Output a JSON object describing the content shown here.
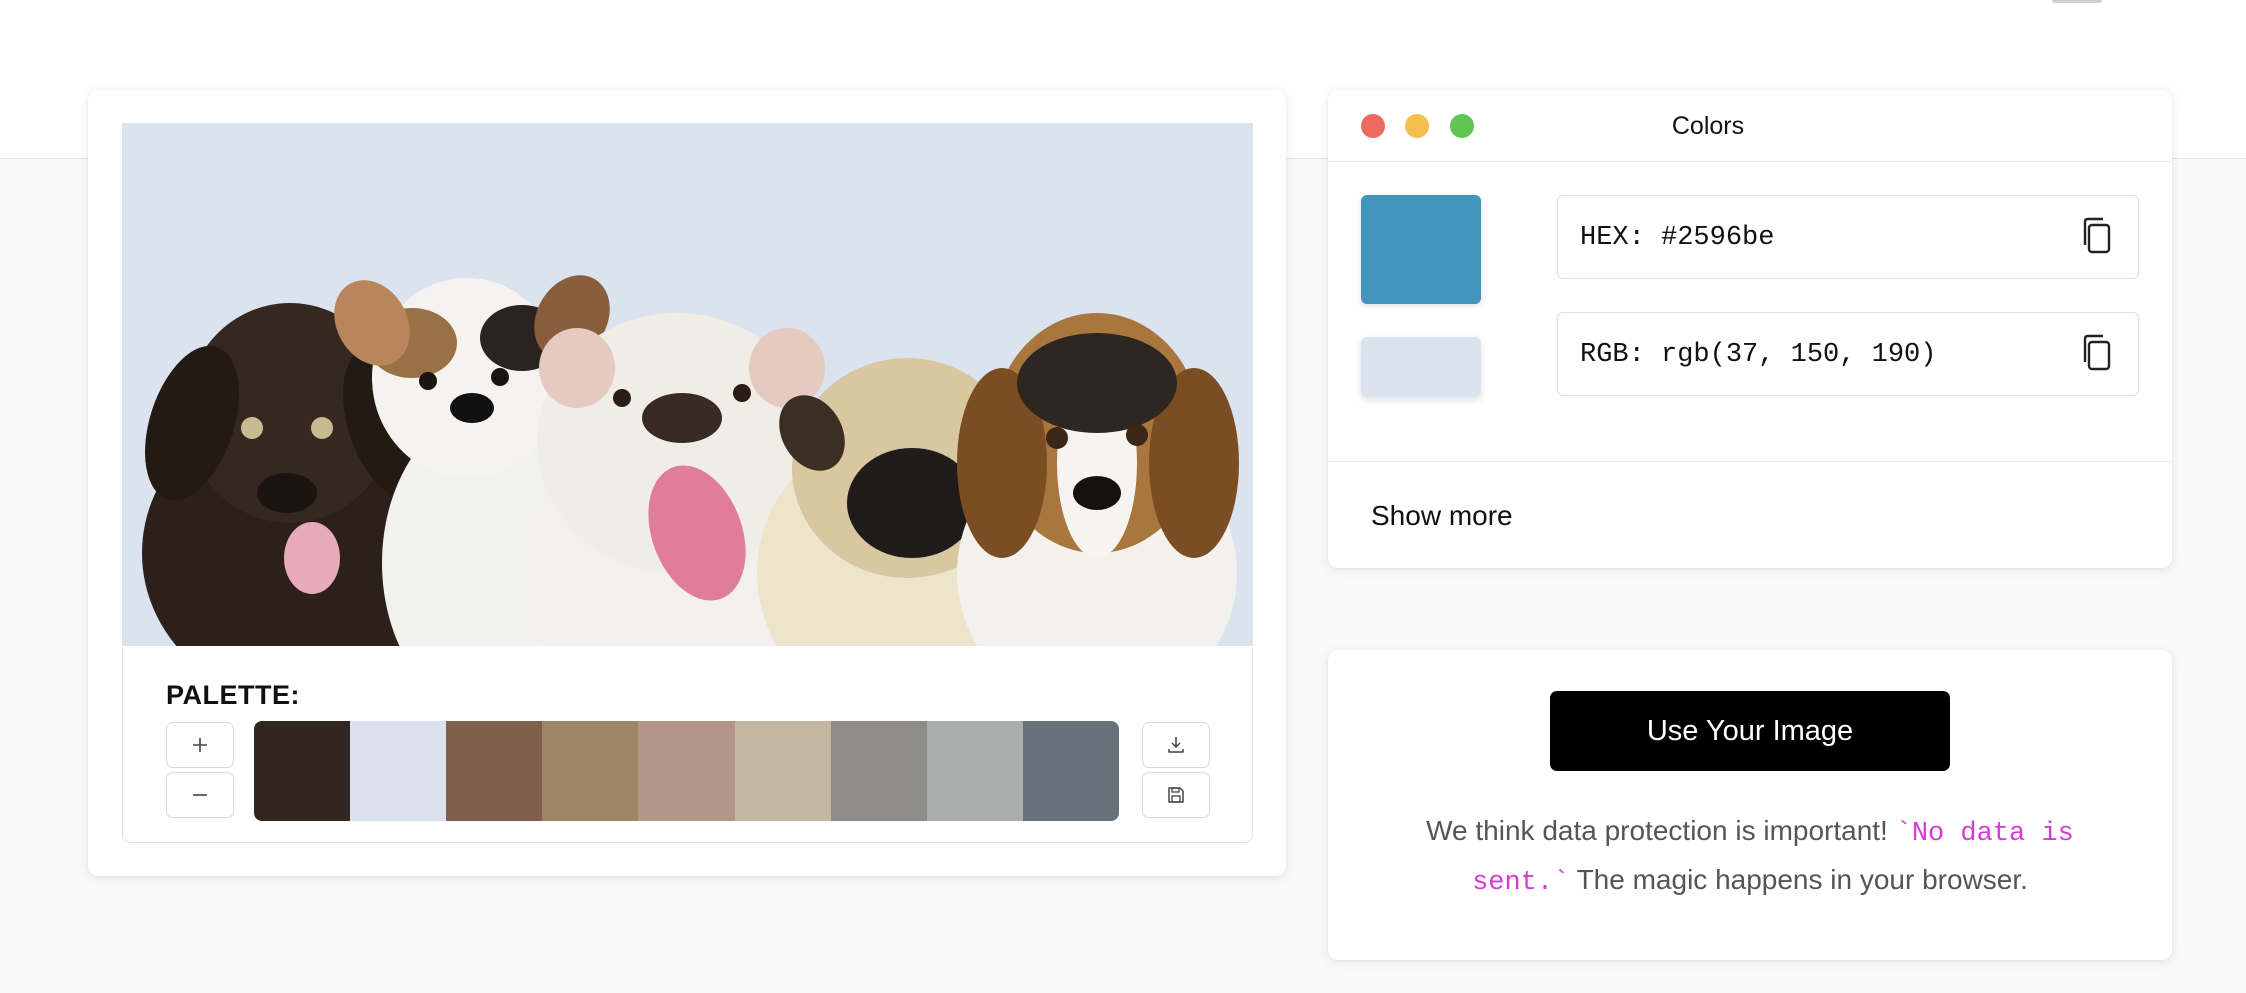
{
  "palette": {
    "title": "PALETTE:",
    "swatches": [
      "#312720",
      "#dae1ec",
      "#805f4c",
      "#9e8566",
      "#b39589",
      "#c4b7a2",
      "#8f8d88",
      "#acadad",
      "#67727a"
    ],
    "add_label": "+",
    "remove_label": "−"
  },
  "colors_panel": {
    "title": "Colors",
    "selected_color": "#4495be",
    "secondary_color": "#dae3ee",
    "hex_text": "HEX: #2596be",
    "rgb_text": "RGB: rgb(37, 150, 190)",
    "show_more_label": "Show more"
  },
  "cta": {
    "button_label": "Use Your Image",
    "notice_before": "We think data protection is important! ",
    "notice_code": "`No data is sent.`",
    "notice_after": " The magic happens in your browser."
  },
  "icons": [
    "plus-icon",
    "minus-icon",
    "download-icon",
    "save-icon",
    "copy-icon"
  ]
}
